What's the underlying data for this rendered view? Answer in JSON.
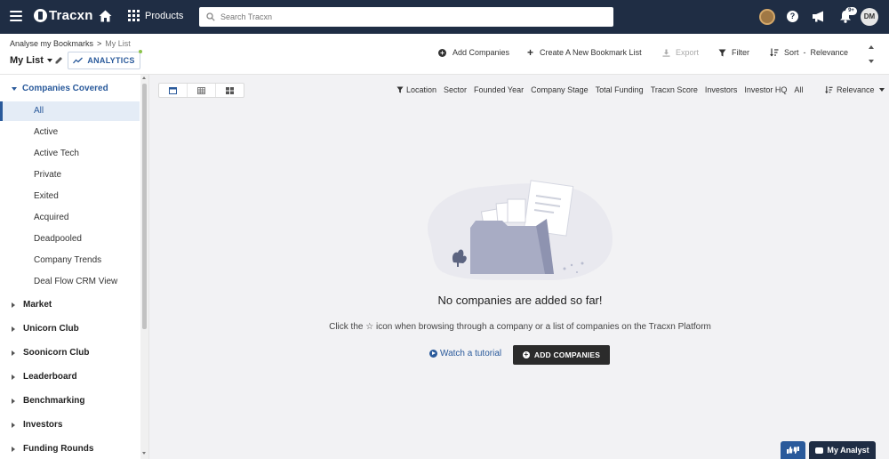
{
  "nav": {
    "logo": "Tracxn",
    "products_label": "Products",
    "search_placeholder": "Search Tracxn",
    "notification_count": "9+",
    "avatar_initials": "DM"
  },
  "header": {
    "breadcrumb": {
      "parent": "Analyse my Bookmarks",
      "separator": ">",
      "current": "My List"
    },
    "list_name": "My List",
    "analytics_label": "ANALYTICS",
    "actions": {
      "add_companies": "Add Companies",
      "create_list": "Create A New Bookmark List",
      "export": "Export",
      "filter": "Filter",
      "sort": "Sort",
      "sort_sep": "-",
      "sort_value": "Relevance"
    }
  },
  "sidebar": {
    "companies_covered": "Companies Covered",
    "items": [
      "All",
      "Active",
      "Active Tech",
      "Private",
      "Exited",
      "Acquired",
      "Deadpooled",
      "Company Trends",
      "Deal Flow CRM View"
    ],
    "sections": [
      "Market",
      "Unicorn Club",
      "Soonicorn Club",
      "Leaderboard",
      "Benchmarking",
      "Investors",
      "Funding Rounds"
    ]
  },
  "filters": {
    "columns": [
      "Location",
      "Sector",
      "Founded Year",
      "Company Stage",
      "Total Funding",
      "Tracxn Score",
      "Investors",
      "Investor HQ",
      "All"
    ],
    "sort_value": "Relevance"
  },
  "empty_state": {
    "title": "No companies are added so far!",
    "subtitle_before": "Click the",
    "subtitle_after": "icon when browsing through a company or a list of companies on the Tracxn Platform",
    "tutorial_link": "Watch a tutorial",
    "add_button": "ADD COMPANIES"
  },
  "footer": {
    "my_analyst": "My Analyst"
  },
  "colors": {
    "nav_bg": "#1f2d44",
    "accent": "#2a5a9b",
    "button_dark": "#2b2b2b"
  },
  "icons": {
    "menu": "hamburger-icon",
    "home": "home-icon",
    "apps": "grid-icon",
    "search": "search-icon",
    "help": "help-icon",
    "announce": "bullhorn-icon",
    "notify": "bell-icon",
    "edit": "pencil-icon",
    "chart": "line-chart-icon"
  }
}
